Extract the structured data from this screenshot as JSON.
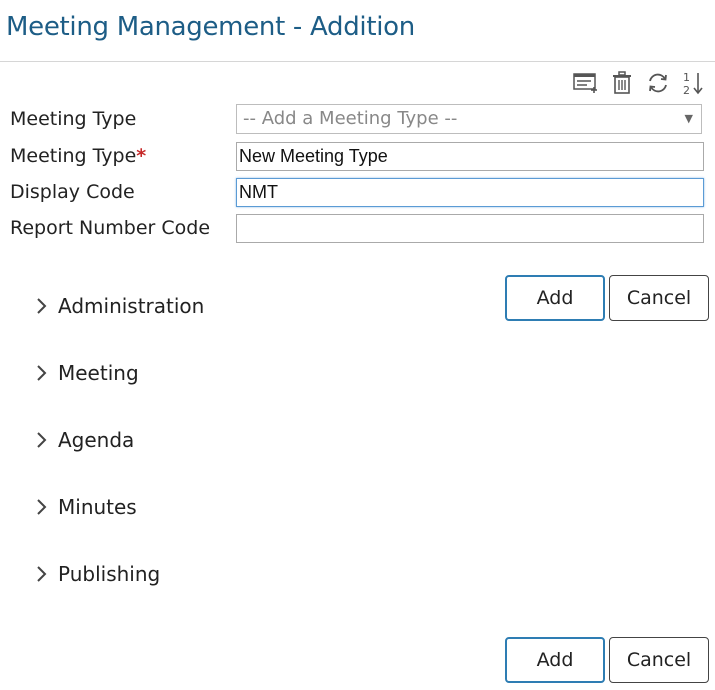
{
  "header": {
    "title": "Meeting Management - Addition"
  },
  "toolbar": {
    "icons": [
      "list-add-icon",
      "trash-icon",
      "refresh-icon",
      "sort-numeric-icon"
    ],
    "sort_top": "1",
    "sort_bottom": "2"
  },
  "form": {
    "meeting_type_select": {
      "label": "Meeting Type",
      "selected": "-- Add a Meeting Type --",
      "arrow": "▼"
    },
    "meeting_type": {
      "label": "Meeting Type",
      "required_mark": "*",
      "value": "New Meeting Type"
    },
    "display_code": {
      "label": "Display Code",
      "value": "NMT"
    },
    "report_number_code": {
      "label": "Report Number Code",
      "value": ""
    }
  },
  "buttons": {
    "add": "Add",
    "cancel": "Cancel"
  },
  "sections": [
    {
      "label": "Administration"
    },
    {
      "label": "Meeting"
    },
    {
      "label": "Agenda"
    },
    {
      "label": "Minutes"
    },
    {
      "label": "Publishing"
    }
  ],
  "colors": {
    "title": "#1d5d86",
    "required": "#c62828",
    "primary_border": "#2e7db3",
    "focus_border": "#5b9bd5"
  }
}
